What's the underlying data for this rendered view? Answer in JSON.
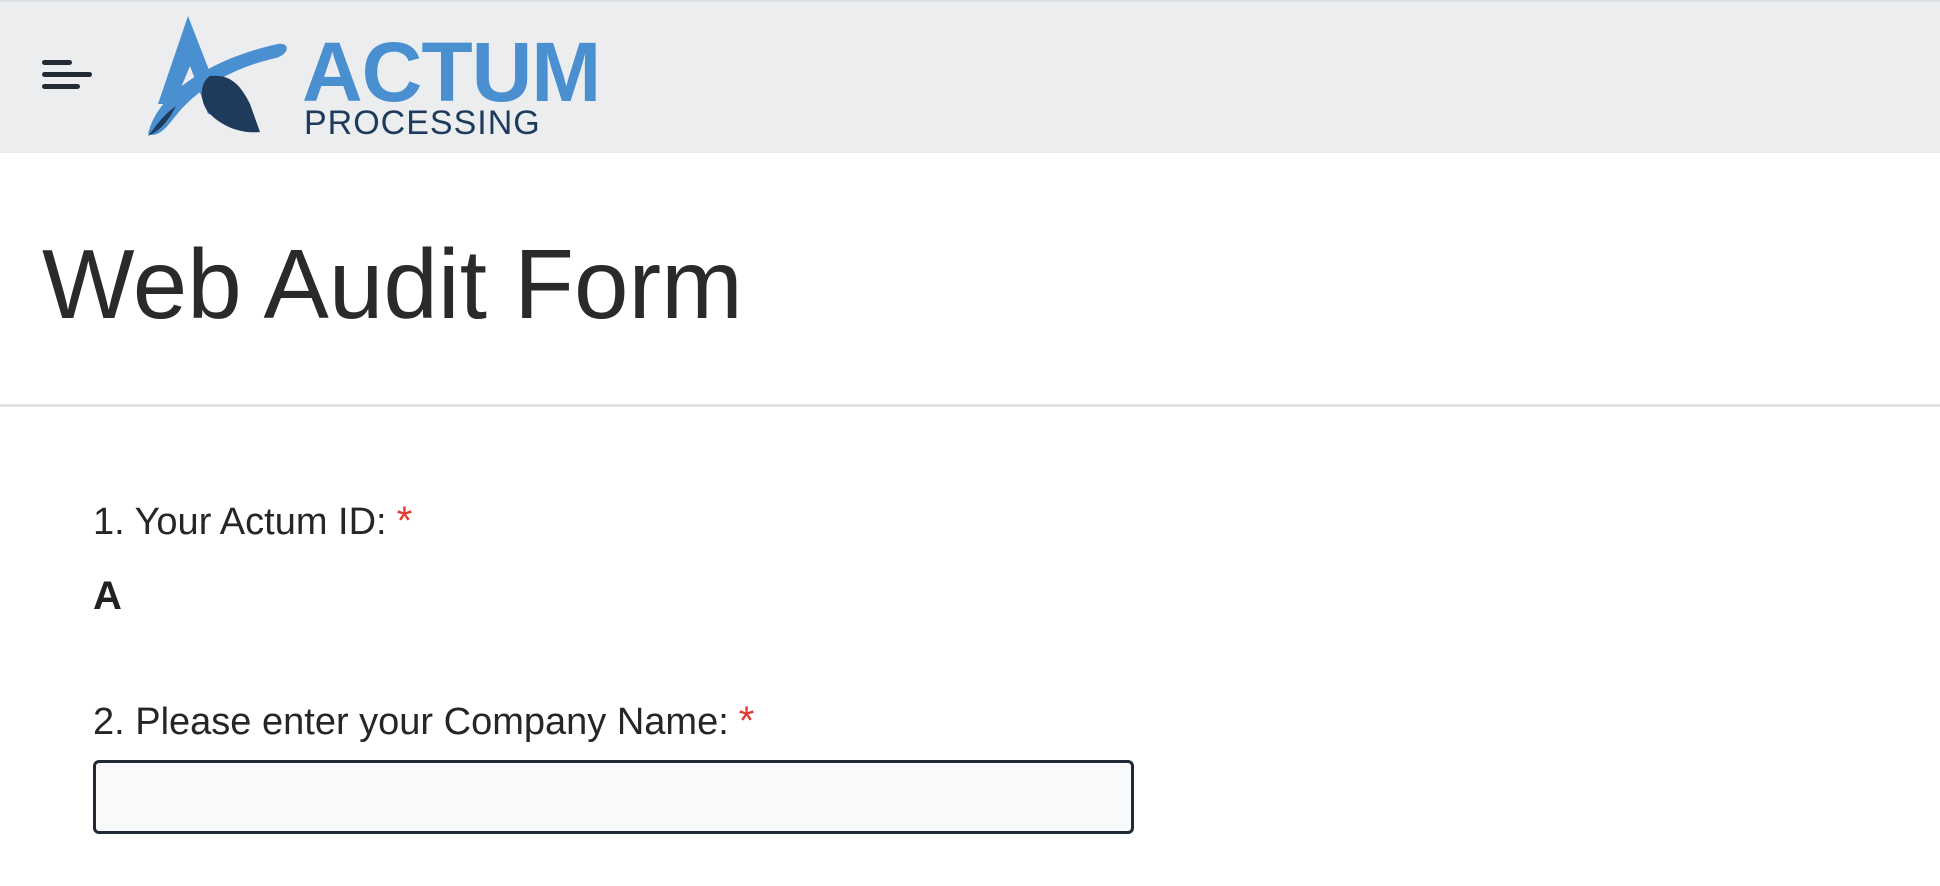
{
  "header": {
    "menu_icon": "hamburger-menu-icon",
    "logo": {
      "word_primary": "ACTUM",
      "word_secondary": "PROCESSING",
      "colors": {
        "primary": "#4a90d0",
        "secondary": "#1f3b5c"
      }
    }
  },
  "page": {
    "title": "Web Audit Form"
  },
  "form": {
    "questions": [
      {
        "label": "1. Your Actum ID:",
        "required_mark": "*",
        "value": "A"
      },
      {
        "label": "2. Please enter your Company Name:",
        "required_mark": "*",
        "input_value": "",
        "placeholder": ""
      }
    ]
  },
  "colors": {
    "header_bg": "#ebedef",
    "required": "#e03a2e",
    "input_border": "#1f2a36"
  }
}
